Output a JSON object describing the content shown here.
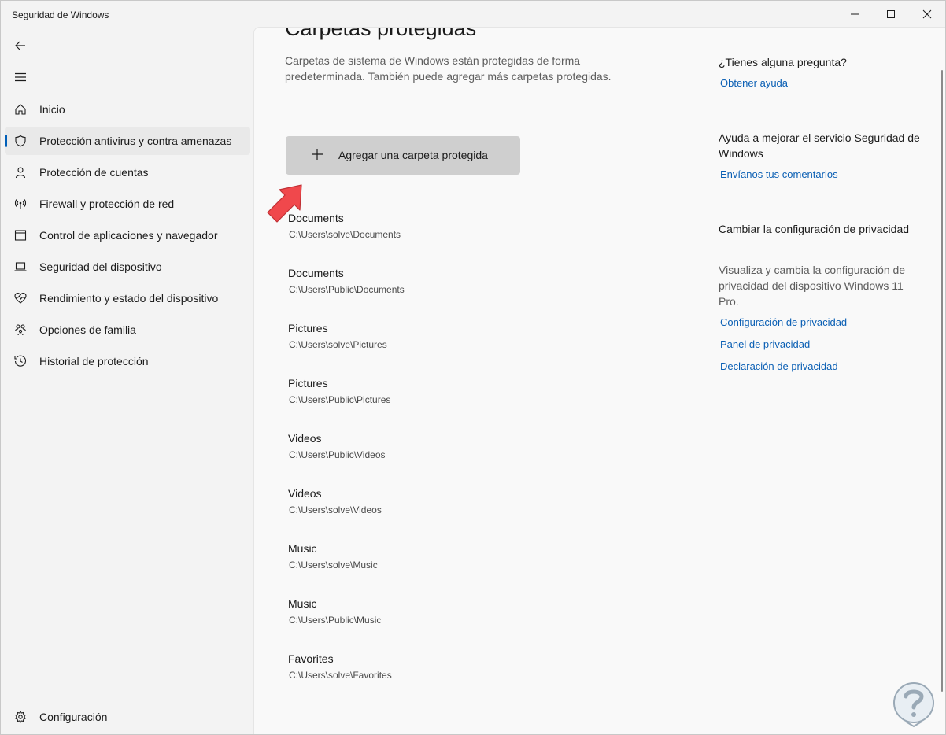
{
  "window": {
    "title": "Seguridad de Windows"
  },
  "sidebar": {
    "items": [
      {
        "label": "Inicio",
        "icon": "home-icon"
      },
      {
        "label": "Protección antivirus y contra amenazas",
        "icon": "shield-icon",
        "selected": true
      },
      {
        "label": "Protección de cuentas",
        "icon": "person-icon"
      },
      {
        "label": "Firewall y protección de red",
        "icon": "antenna-icon"
      },
      {
        "label": "Control de aplicaciones y navegador",
        "icon": "browser-window-icon"
      },
      {
        "label": "Seguridad del dispositivo",
        "icon": "laptop-icon"
      },
      {
        "label": "Rendimiento y estado del dispositivo",
        "icon": "heart-pulse-icon"
      },
      {
        "label": "Opciones de familia",
        "icon": "family-icon"
      },
      {
        "label": "Historial de protección",
        "icon": "history-icon"
      }
    ],
    "settings_label": "Configuración"
  },
  "main": {
    "title": "Carpetas protegidas",
    "description": "Carpetas de sistema de Windows están protegidas de forma predeterminada. También puede agregar más carpetas protegidas.",
    "add_button_label": "Agregar una carpeta protegida",
    "folders": [
      {
        "name": "Documents",
        "path": "C:\\Users\\solve\\Documents"
      },
      {
        "name": "Documents",
        "path": "C:\\Users\\Public\\Documents"
      },
      {
        "name": "Pictures",
        "path": "C:\\Users\\solve\\Pictures"
      },
      {
        "name": "Pictures",
        "path": "C:\\Users\\Public\\Pictures"
      },
      {
        "name": "Videos",
        "path": "C:\\Users\\Public\\Videos"
      },
      {
        "name": "Videos",
        "path": "C:\\Users\\solve\\Videos"
      },
      {
        "name": "Music",
        "path": "C:\\Users\\solve\\Music"
      },
      {
        "name": "Music",
        "path": "C:\\Users\\Public\\Music"
      },
      {
        "name": "Favorites",
        "path": "C:\\Users\\solve\\Favorites"
      }
    ]
  },
  "side_panel": {
    "question_heading": "¿Tienes alguna pregunta?",
    "help_link": "Obtener ayuda",
    "improve_heading": "Ayuda a mejorar el servicio Seguridad de Windows",
    "feedback_link": "Envíanos tus comentarios",
    "privacy_heading": "Cambiar la configuración de privacidad",
    "privacy_text": "Visualiza y cambia la configuración de privacidad del dispositivo Windows 11 Pro.",
    "privacy_links": [
      "Configuración de privacidad",
      "Panel de privacidad",
      "Declaración de privacidad"
    ]
  },
  "colors": {
    "accent": "#005fb8",
    "link": "#0a5fb4",
    "annotation_arrow": "#f0484c"
  }
}
